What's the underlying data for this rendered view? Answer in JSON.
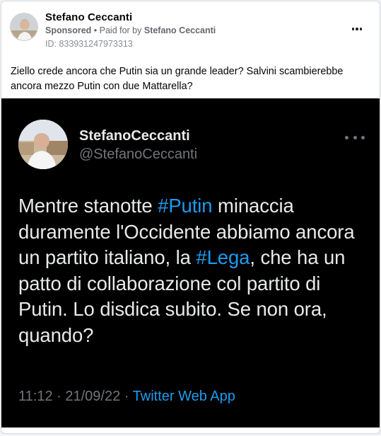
{
  "post": {
    "author": "Stefano Ceccanti",
    "sponsored_label": "Sponsored",
    "separator": " • ",
    "paid_for_prefix": "Paid for by ",
    "paid_for_name": "Stefano Ceccanti",
    "ad_id": "ID: 833931247973313",
    "text": "Ziello crede ancora che Putin sia un grande leader? Salvini scambierebbe ancora mezzo Putin con due Mattarella?",
    "more_icon": "more-horizontal-icon"
  },
  "tweet": {
    "display_name": "StefanoCeccanti",
    "handle": "@StefanoCeccanti",
    "body": {
      "t1": "Mentre stanotte ",
      "tag1": "#Putin",
      "t2": " minaccia duramente l'Occidente abbiamo ancora un partito italiano, la ",
      "tag2": "#Lega",
      "t3": ", che ha un patto di collaborazione col partito di Putin. Lo disdica subito. Se non ora, quando?"
    },
    "time": "11:12",
    "date": "21/09/22",
    "sep": " · ",
    "app": "Twitter Web App",
    "colors": {
      "background": "#000000",
      "text": "#e7e9ea",
      "muted": "#71767b",
      "link": "#1d9bf0"
    }
  }
}
